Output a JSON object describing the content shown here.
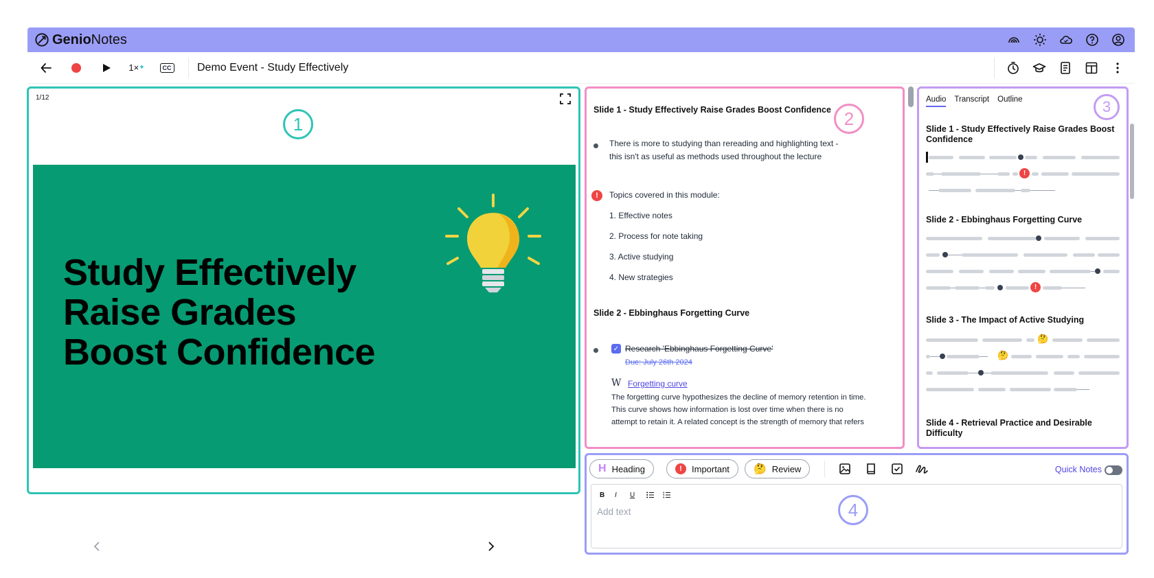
{
  "app": {
    "logo_bold": "Genio",
    "logo_light": "Notes"
  },
  "toolbar": {
    "speed": "1×",
    "cc_label": "CC",
    "title": "Demo Event - Study Effectively"
  },
  "slide": {
    "counter": "1/12",
    "title_lines": [
      "Study Effectively",
      "Raise Grades",
      "Boost Confidence"
    ],
    "bg_color": "#069b72"
  },
  "badges": {
    "one": "1",
    "two": "2",
    "three": "3",
    "four": "4"
  },
  "notes": {
    "h1": "Slide 1 - Study Effectively Raise Grades Boost Confidence",
    "p1_line1": "There is more to studying than rereading and highlighting text -",
    "p1_line2": "this isn't as useful as methods used throughout the lecture",
    "topics_intro": "Topics covered in this module:",
    "topics": [
      "1. Effective notes",
      "2. Process for note taking",
      "3. Active studying",
      "4. New strategies"
    ],
    "h2": "Slide 2 - Ebbinghaus Forgetting Curve",
    "task": "Research 'Ebbinghaus Forgetting Curve'",
    "due": "Due: July 26th 2024",
    "link_icon": "W",
    "link_text": "Forgetting curve",
    "desc_line1": "The forgetting curve hypothesizes the decline of memory retention in time.",
    "desc_line2": "This curve shows how information is lost over time when there is no",
    "desc_line3": "attempt to retain it. A related concept is the strength of memory that refers"
  },
  "audio": {
    "tabs": [
      "Audio",
      "Transcript",
      "Outline"
    ],
    "s1": "Slide 1 - Study Effectively Raise Grades Boost Confidence",
    "s2": "Slide 2 - Ebbinghaus Forgetting Curve",
    "s3": "Slide 3 - The Impact of Active Studying",
    "s4": "Slide 4 - Retrieval Practice and Desirable Difficulty"
  },
  "quick": {
    "chip_heading": "Heading",
    "chip_heading_icon": "H",
    "chip_important": "Important",
    "chip_review": "Review",
    "quick_notes": "Quick Notes",
    "fmt": [
      "B",
      "I",
      "U"
    ],
    "placeholder": "Add text"
  },
  "colors": {
    "topbar": "#9a9df6",
    "region1": "#2ec4b6",
    "region2": "#f28ec4",
    "region3": "#c39bf2",
    "region4": "#9a9df6",
    "important": "#ef4444"
  },
  "icons": {
    "topbar": [
      "signal-icon",
      "sun-icon",
      "cloud-icon",
      "help-icon",
      "account-icon"
    ],
    "toolbar_right": [
      "timer-icon",
      "graduation-cap-icon",
      "document-icon",
      "layout-icon",
      "more-icon"
    ]
  }
}
